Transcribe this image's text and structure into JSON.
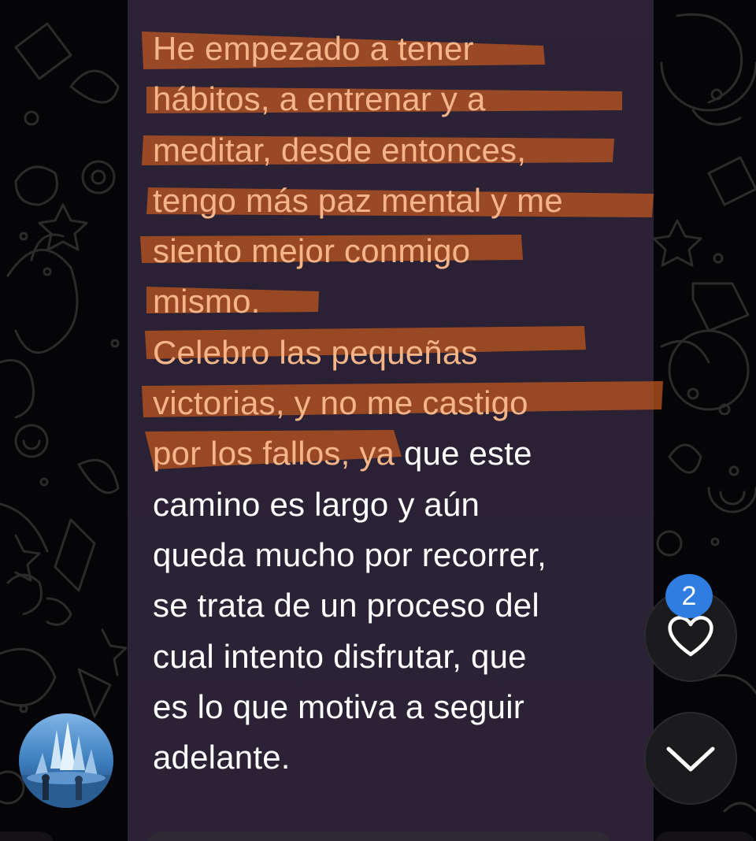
{
  "message": {
    "lines": [
      {
        "text": "He empezado a tener",
        "highlighted": true
      },
      {
        "text": "hábitos, a entrenar y a",
        "highlighted": true
      },
      {
        "text": "meditar, desde entonces,",
        "highlighted": true
      },
      {
        "text": "tengo más paz mental y me",
        "highlighted": true
      },
      {
        "text": "siento mejor conmigo",
        "highlighted": true
      },
      {
        "text": "mismo.",
        "highlighted": true
      },
      {
        "text": "Celebro las pequeñas",
        "highlighted": true
      },
      {
        "text": "victorias, y no me castigo",
        "highlighted": true
      },
      {
        "text": "por los fallos, ya que este",
        "highlighted": "partial",
        "highlight_part": "por los fallos, ya",
        "rest": " que este"
      },
      {
        "text": "camino es largo y aún",
        "highlighted": false
      },
      {
        "text": "queda mucho por recorrer,",
        "highlighted": false
      },
      {
        "text": "se trata de un proceso del",
        "highlighted": false
      },
      {
        "text": "cual intento disfrutar, que",
        "highlighted": false
      },
      {
        "text": "es lo que motiva a seguir",
        "highlighted": false
      },
      {
        "text": "adelante.",
        "highlighted": false
      }
    ]
  },
  "reactions": {
    "count": "2",
    "icon": "heart-icon"
  },
  "scroll_button": {
    "icon": "chevron-down-icon"
  },
  "colors": {
    "bubble": "#2b2236",
    "highlight_marker": "#c4581f",
    "highlighted_text": "#f6b589",
    "text": "#ffffff",
    "badge": "#2f7de1",
    "wallpaper_doodle": "#2a2a2a"
  }
}
